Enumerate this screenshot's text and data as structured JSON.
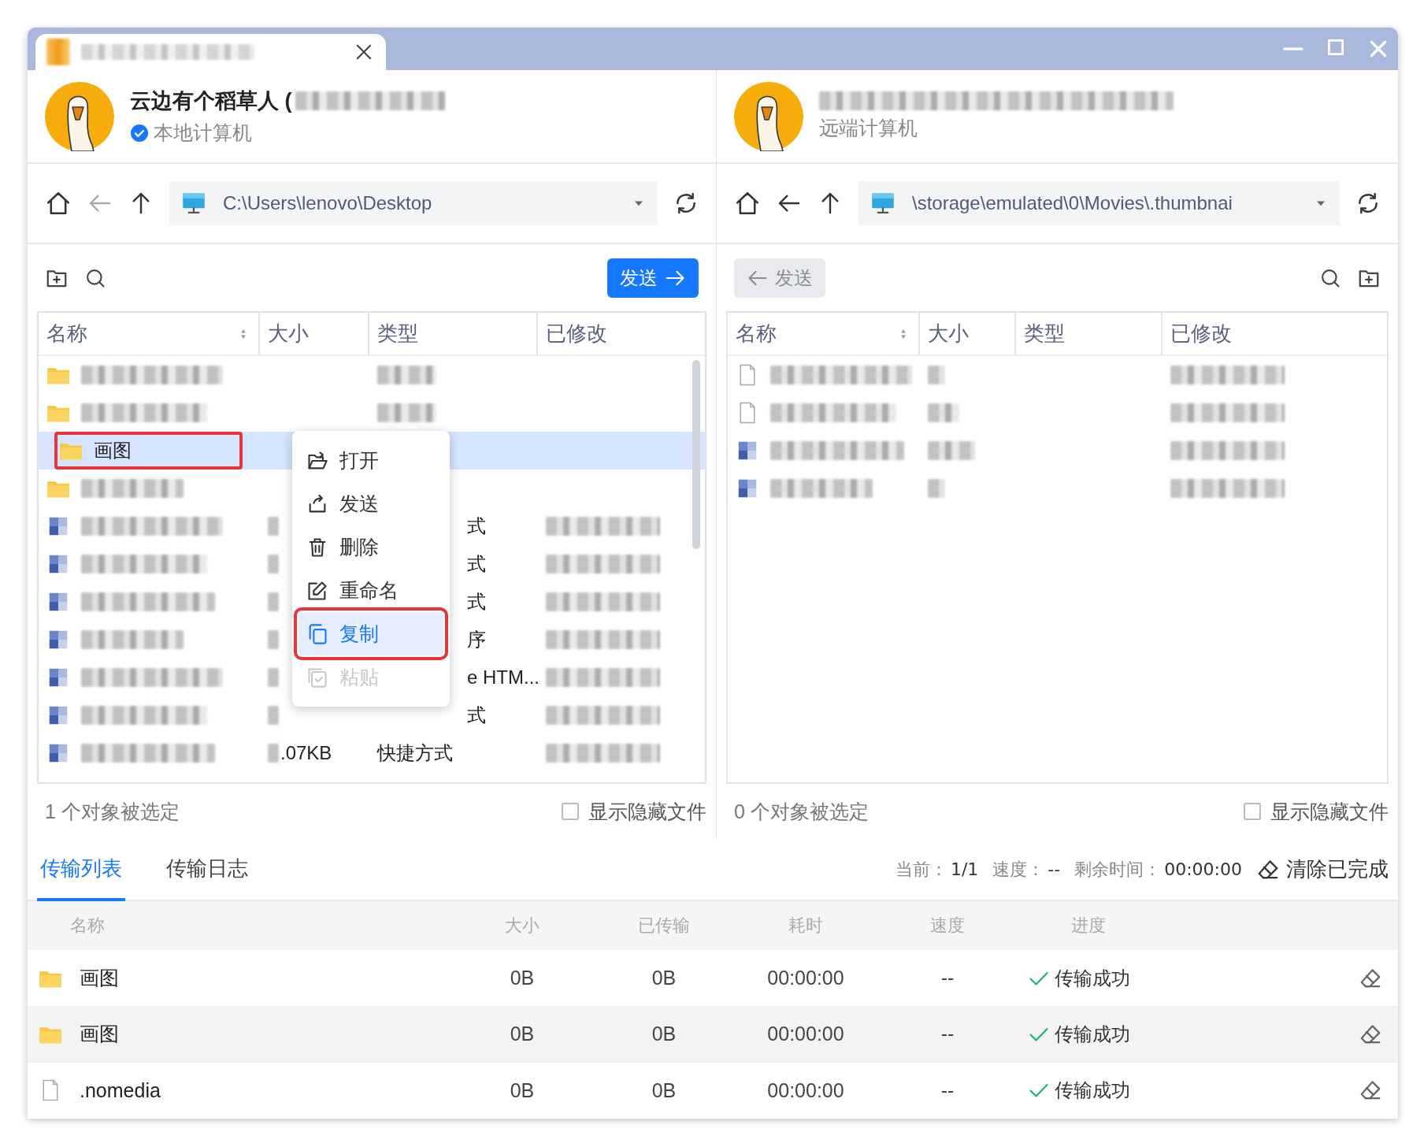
{
  "panes": [
    {
      "kind": "local",
      "name": "云边有个稻草人 (",
      "verified": true,
      "subtitle": "本地计算机",
      "path": "C:\\Users\\lenovo\\Desktop",
      "back_disabled": true,
      "transfer_button": {
        "label": "发送",
        "kind": "send",
        "disabled": false
      },
      "columns": [
        {
          "label": "名称",
          "sortable": true
        },
        {
          "label": "大小",
          "sortable": false
        },
        {
          "label": "类型",
          "sortable": false
        },
        {
          "label": "已修改",
          "sortable": false
        }
      ],
      "rows": [
        {
          "kind": "folder",
          "selected": false
        },
        {
          "kind": "folder",
          "selected": false
        },
        {
          "kind": "folder",
          "name": "画图",
          "selected": true,
          "annotated": true
        },
        {
          "kind": "folder",
          "selected": false,
          "under_menu": true
        },
        {
          "kind": "image",
          "selected": false,
          "under_menu": true,
          "type": "式"
        },
        {
          "kind": "image",
          "selected": false,
          "under_menu": true,
          "type": "式"
        },
        {
          "kind": "image",
          "selected": false,
          "under_menu": true,
          "type": "式"
        },
        {
          "kind": "image",
          "selected": false,
          "under_menu": true,
          "type": "序"
        },
        {
          "kind": "image",
          "selected": false,
          "under_menu": true,
          "type": "e HTM..."
        },
        {
          "kind": "image",
          "selected": false,
          "under_menu": true,
          "type": "式"
        },
        {
          "kind": "image",
          "selected": false,
          "size": ".07KB",
          "type": "快捷方式"
        }
      ],
      "context_menu": [
        {
          "label": "打开",
          "kind": "open",
          "hovered": false,
          "disabled": false,
          "annotated": false
        },
        {
          "label": "发送",
          "kind": "send",
          "hovered": false,
          "disabled": false,
          "annotated": false
        },
        {
          "label": "删除",
          "kind": "delete",
          "hovered": false,
          "disabled": false,
          "annotated": false
        },
        {
          "label": "重命名",
          "kind": "rename",
          "hovered": false,
          "disabled": false,
          "annotated": false
        },
        {
          "label": "复制",
          "kind": "copy",
          "hovered": true,
          "disabled": false,
          "annotated": true
        },
        {
          "label": "粘贴",
          "kind": "paste",
          "hovered": false,
          "disabled": true,
          "annotated": false
        }
      ],
      "status": "1 个对象被选定",
      "show_hidden": {
        "label": "显示隐藏文件",
        "checked": false
      }
    },
    {
      "kind": "remote",
      "verified": false,
      "subtitle": "远端计算机",
      "path": "\\storage\\emulated\\0\\Movies\\.thumbnai",
      "back_disabled": false,
      "transfer_button": {
        "label": "发送",
        "kind": "receive",
        "disabled": true
      },
      "columns": [
        {
          "label": "名称",
          "sortable": true
        },
        {
          "label": "大小",
          "sortable": false
        },
        {
          "label": "类型",
          "sortable": false
        },
        {
          "label": "已修改",
          "sortable": false
        }
      ],
      "rows": [
        {
          "kind": "file",
          "selected": false
        },
        {
          "kind": "file",
          "selected": false
        },
        {
          "kind": "image",
          "selected": false
        },
        {
          "kind": "image",
          "selected": false
        }
      ],
      "status": "0 个对象被选定",
      "show_hidden": {
        "label": "显示隐藏文件",
        "checked": false
      }
    }
  ],
  "transfer": {
    "tabs": [
      {
        "label": "传输列表",
        "selected": true
      },
      {
        "label": "传输日志",
        "selected": false
      }
    ],
    "stats": [
      {
        "label": "当前：",
        "value": "1/1"
      },
      {
        "label": "速度：",
        "value": "--"
      },
      {
        "label": "剩余时间：",
        "value": "00:00:00"
      }
    ],
    "clear_button": "清除已完成",
    "columns": [
      "名称",
      "大小",
      "已传输",
      "耗时",
      "速度",
      "进度"
    ],
    "rows": [
      {
        "kind": "folder",
        "name": "画图",
        "size": "0B",
        "transferred": "0B",
        "elapsed": "00:00:00",
        "speed": "--",
        "status": "传输成功",
        "success": true,
        "hovered": false
      },
      {
        "kind": "folder",
        "name": "画图",
        "size": "0B",
        "transferred": "0B",
        "elapsed": "00:00:00",
        "speed": "--",
        "status": "传输成功",
        "success": true,
        "hovered": true
      },
      {
        "kind": "file",
        "name": ".nomedia",
        "size": "0B",
        "transferred": "0B",
        "elapsed": "00:00:00",
        "speed": "--",
        "status": "传输成功",
        "success": true,
        "hovered": false
      }
    ]
  }
}
